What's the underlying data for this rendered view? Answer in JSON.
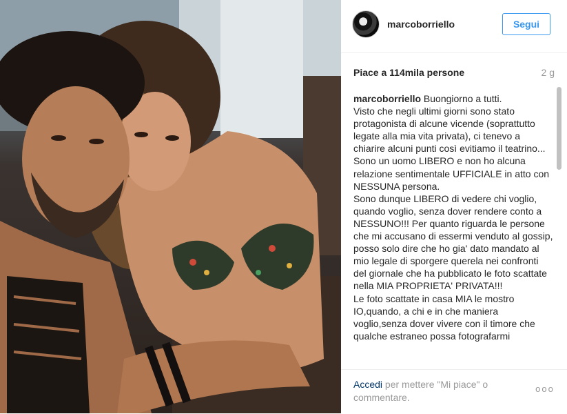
{
  "post": {
    "username": "marcoborriello",
    "follow_label": "Segui",
    "likes_text": "Piace a 114mila persone",
    "time_ago": "2 g",
    "caption_user": "marcoborriello",
    "caption_lines": [
      "Buongiorno a tutti.",
      "Visto che negli ultimi giorni sono stato protagonista di alcune vicende (soprattutto legate alla mia vita privata), ci tenevo a chiarire alcuni punti così evitiamo il teatrino... Sono un uomo LIBERO e non ho alcuna relazione sentimentale UFFICIALE in atto con NESSUNA persona.",
      "Sono dunque LIBERO di vedere chi voglio, quando voglio, senza dover rendere conto a NESSUNO!!! Per quanto riguarda le persone che mi accusano di essermi venduto al gossip, posso solo dire che ho gia' dato mandato al mio legale di sporgere querela nei confronti del giornale che ha pubblicato le foto scattate nella MIA PROPRIETA' PRIVATA!!!",
      "Le foto scattate in casa MIA le mostro IO,quando, a chi e in che maniera voglio,senza dover vivere con il timore che qualche estraneo possa fotografarmi"
    ],
    "login_link": "Accedi",
    "login_rest": " per mettere \"Mi piace\" o commentare.",
    "more_glyph": "ooo"
  },
  "icons": {
    "avatar": "profile-picture",
    "more": "more-options-icon"
  }
}
